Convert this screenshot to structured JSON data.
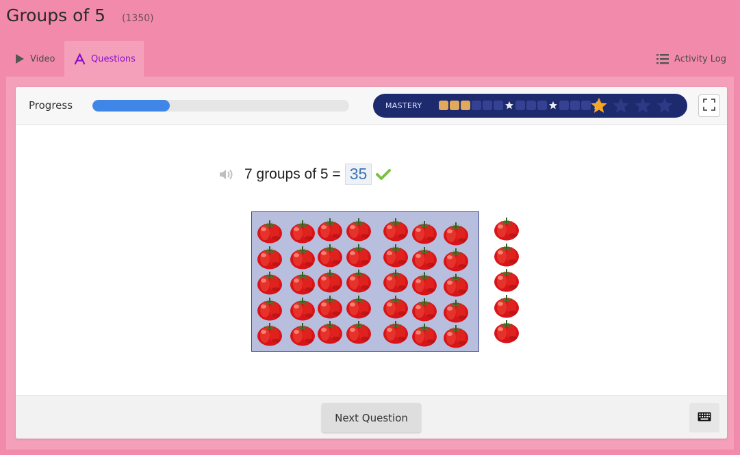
{
  "header": {
    "title": "Groups of 5",
    "code": "(1350)"
  },
  "tabs": {
    "video": "Video",
    "questions": "Questions",
    "activity_log": "Activity Log"
  },
  "progress": {
    "label": "Progress",
    "fraction": 0.3,
    "color": "#3f86e6"
  },
  "mastery": {
    "label": "MASTERY",
    "completed_cells": 3,
    "total_cells": 15,
    "big_stars_total": 4,
    "big_stars_earned": 1,
    "gold": "#f5a623"
  },
  "question": {
    "text": "7 groups of 5 =",
    "answer": "35",
    "correct": true,
    "groups": 7,
    "per_group": 5,
    "extra_groups": 1
  },
  "footer": {
    "next_label": "Next Question"
  },
  "icons": {
    "video": "play-icon",
    "questions": "letter-a-icon",
    "activity_log": "list-icon",
    "fullscreen": "fullscreen-icon",
    "speaker": "speaker-icon",
    "check": "checkmark-icon",
    "keyboard": "keyboard-icon"
  }
}
